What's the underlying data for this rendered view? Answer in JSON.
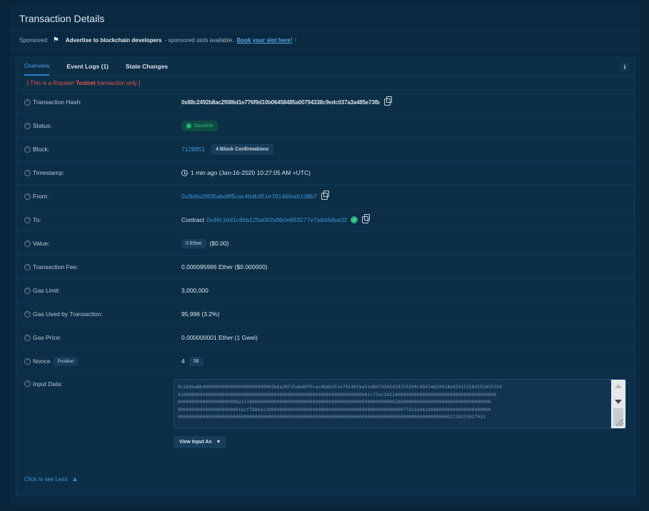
{
  "page": {
    "title": "Transaction Details"
  },
  "sponsor": {
    "prefix": "Sponsored:",
    "bold": "Advertise to blockchain developers",
    "text": "- sponsored slots available.",
    "link": "Book your slot here!",
    "info": "i"
  },
  "tabs": [
    {
      "label": "Overview"
    },
    {
      "label": "Event Logs (1)"
    },
    {
      "label": "State Changes"
    }
  ],
  "tab_more": "i",
  "testnet": {
    "pre": "[ This is a Ropsten",
    "bold": "Testnet",
    "post": "transaction only ]"
  },
  "fields": {
    "hash": {
      "label": "Transaction Hash:",
      "value": "0x88c2492b8ac2f086d1e776f9d10b06458485a00794338c9edc037a3a485e73fb"
    },
    "status": {
      "label": "Status:",
      "value": "Success"
    },
    "block": {
      "label": "Block:",
      "value": "7129851",
      "confirmations": "4 Block Confirmations"
    },
    "timestamp": {
      "label": "Timestamp:",
      "value": "1 min ago (Jan-16-2020 10:27:05 AM +UTC)"
    },
    "from": {
      "label": "From:",
      "value": "0x3b6a39f35abd8f5cac4bdb351e78146fea51d8b7"
    },
    "to": {
      "label": "To:",
      "prefix": "Contract",
      "value": "0x48c16d1c6bb125a062a9b0e863277e7a6d4dea32"
    },
    "value": {
      "label": "Value:",
      "pill": "0 Ether",
      "usd": "($0.00)"
    },
    "fee": {
      "label": "Transaction Fee:",
      "value": "0.000095996 Ether ($0.000000)"
    },
    "gas_limit": {
      "label": "Gas Limit:",
      "value": "3,000,000"
    },
    "gas_used": {
      "label": "Gas Used by Transaction:",
      "value": "95,996 (3.2%)"
    },
    "gas_price": {
      "label": "Gas Price:",
      "value": "0.000000001 Ether (1 Gwei)"
    },
    "nonce": {
      "label": "Nonce",
      "position_label": "Position",
      "value": "4",
      "position": "38"
    },
    "input": {
      "label": "Input Data:",
      "line1": "0x1b9ba8b40000000000000000000000003b6a39f35abd8f5cac4bdb351e78146fea51d8b74245424259204c48414d20414b424152284152455354",
      "line2": "4100000000000000000000000000000000000000000000000000000000000000000001c75ac24210000000000000000000000000000000000000",
      "line3": "0000000000000000000099a3118000000000000000000000000000000000000000000000000000010000000000000000000000000000000000",
      "line4": "00000000000000000000001bcf788b4210000000000000000000000000000000000000000000000000774316d41d0800000000000000000000",
      "line5": "000000000000000000000000000000000000000000000000000000000000000000000000000000000000000000000000000332833302f931",
      "button": "View Input As"
    }
  },
  "see_less": "Click to see Less"
}
